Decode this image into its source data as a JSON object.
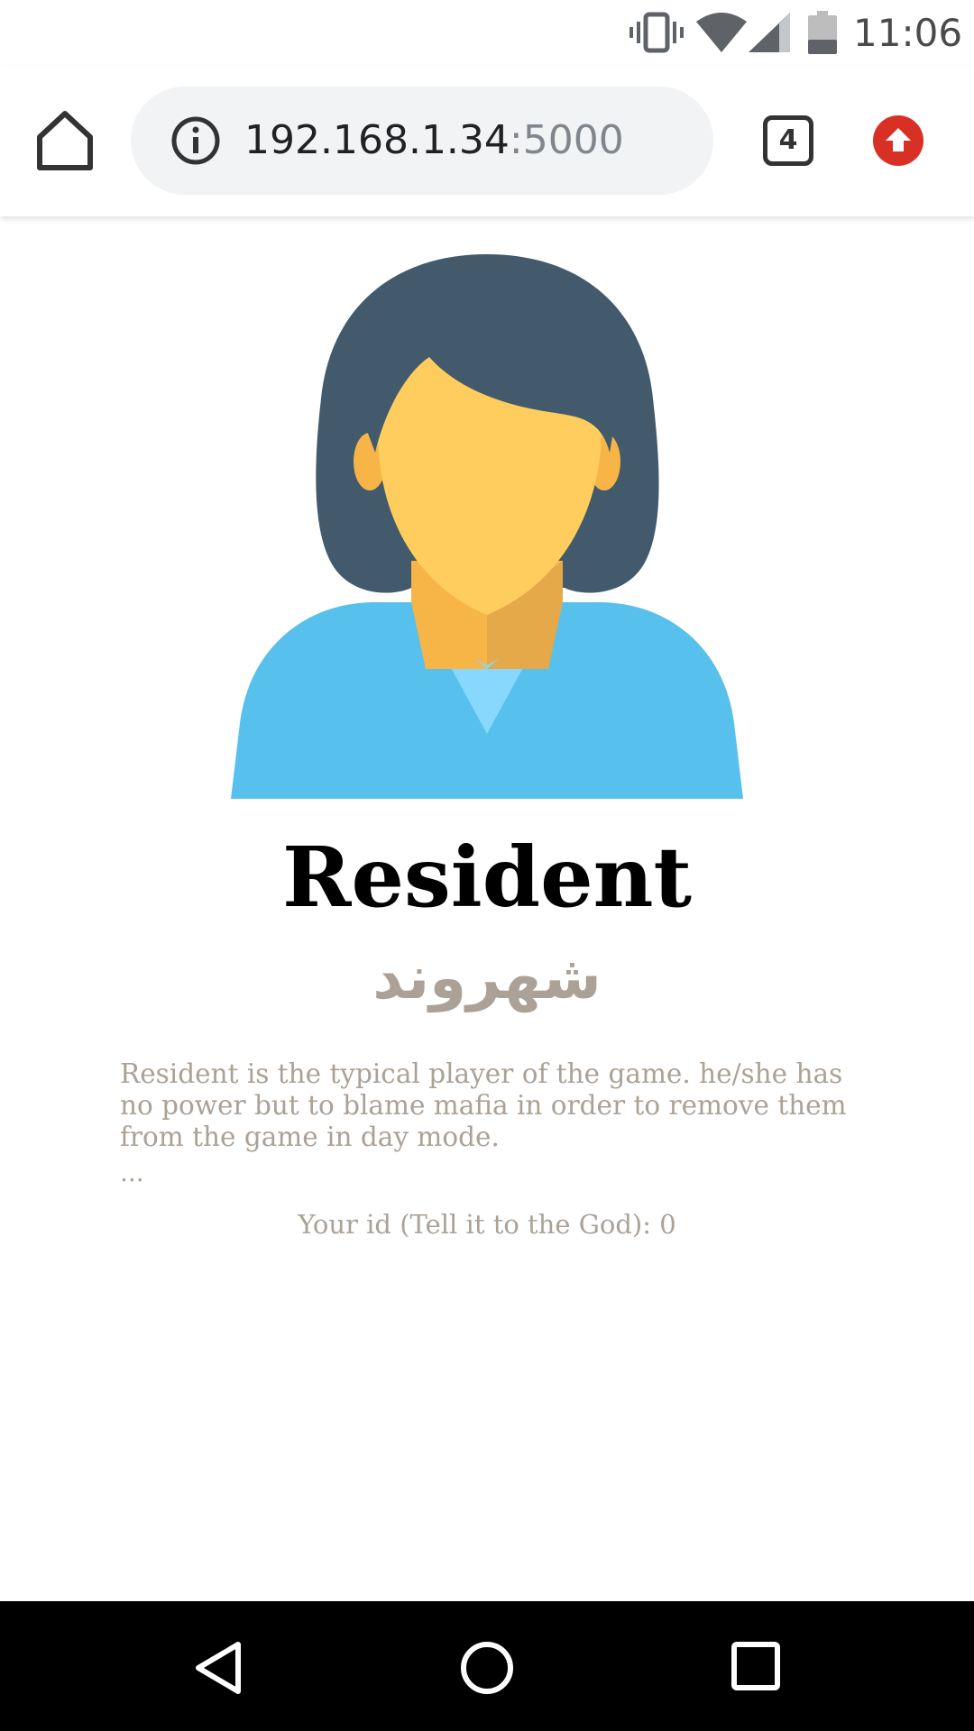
{
  "status_bar": {
    "time": "11:06",
    "icons": [
      "vibrate-icon",
      "wifi-icon",
      "cell-signal-icon",
      "battery-icon"
    ]
  },
  "browser": {
    "url_host": "192.168.1.34",
    "url_port": ":5000",
    "tab_count": "4",
    "icons": [
      "home-icon",
      "info-icon",
      "tab-switcher-icon",
      "update-icon"
    ],
    "colors": {
      "omnibox_bg": "#f1f3f4",
      "update_badge": "#d93025"
    }
  },
  "role": {
    "title": "Resident",
    "subtitle": "شهروند",
    "description": "Resident is the typical player of the game. he/she has no power but to blame mafia in order to remove them from the game in day mode.",
    "ellipsis": "...",
    "player_id": "Your id (Tell it to the God): 0",
    "colors": {
      "text_muted": "#aba196",
      "hair": "#425a6c",
      "skin": "#fecd5d",
      "shirt": "#58c0ec"
    }
  },
  "nav_bar": {
    "icons": [
      "back-icon",
      "home-circle-icon",
      "recents-icon"
    ]
  }
}
